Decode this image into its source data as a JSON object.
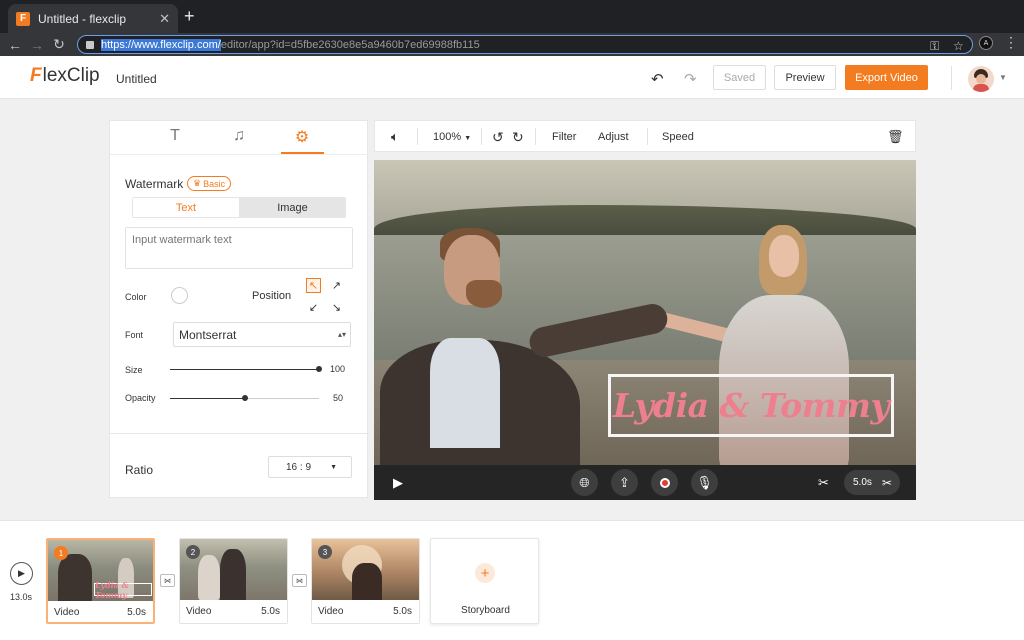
{
  "browser": {
    "tab_title": "Untitled - flexclip",
    "favicon_letter": "F",
    "url_selected": "https://www.flexclip.com/",
    "url_rest": "editor/app?id=d5fbe2630e8e5a9460b7ed69988fb115",
    "extension_label": "A"
  },
  "header": {
    "logo_mark": "F",
    "logo_text": "lexClip",
    "doc_title": "Untitled",
    "saved_label": "Saved",
    "preview_label": "Preview",
    "export_label": "Export Video"
  },
  "panel": {
    "watermark_label": "Watermark",
    "badge_label": "Basic",
    "seg_text": "Text",
    "seg_image": "Image",
    "input_placeholder": "Input watermark text",
    "color_label": "Color",
    "position_label": "Position",
    "font_label": "Font",
    "font_value": "Montserrat",
    "size_label": "Size",
    "size_value": "100",
    "size_fraction": 1.0,
    "opacity_label": "Opacity",
    "opacity_value": "50",
    "opacity_fraction": 0.5,
    "ratio_label": "Ratio",
    "ratio_value": "16 : 9"
  },
  "editor": {
    "zoom": "100%",
    "filter_label": "Filter",
    "adjust_label": "Adjust",
    "speed_label": "Speed",
    "watermark_text": "Lydia & Tommy",
    "duration": "5.0s"
  },
  "timeline": {
    "total": "13.0s",
    "clips": [
      {
        "num": "1",
        "type": "Video",
        "dur": "5.0s"
      },
      {
        "num": "2",
        "type": "Video",
        "dur": "5.0s"
      },
      {
        "num": "3",
        "type": "Video",
        "dur": "5.0s"
      }
    ],
    "storyboard_label": "Storyboard"
  },
  "colors": {
    "accent": "#f47c20",
    "watermark": "#ee7f8e"
  }
}
